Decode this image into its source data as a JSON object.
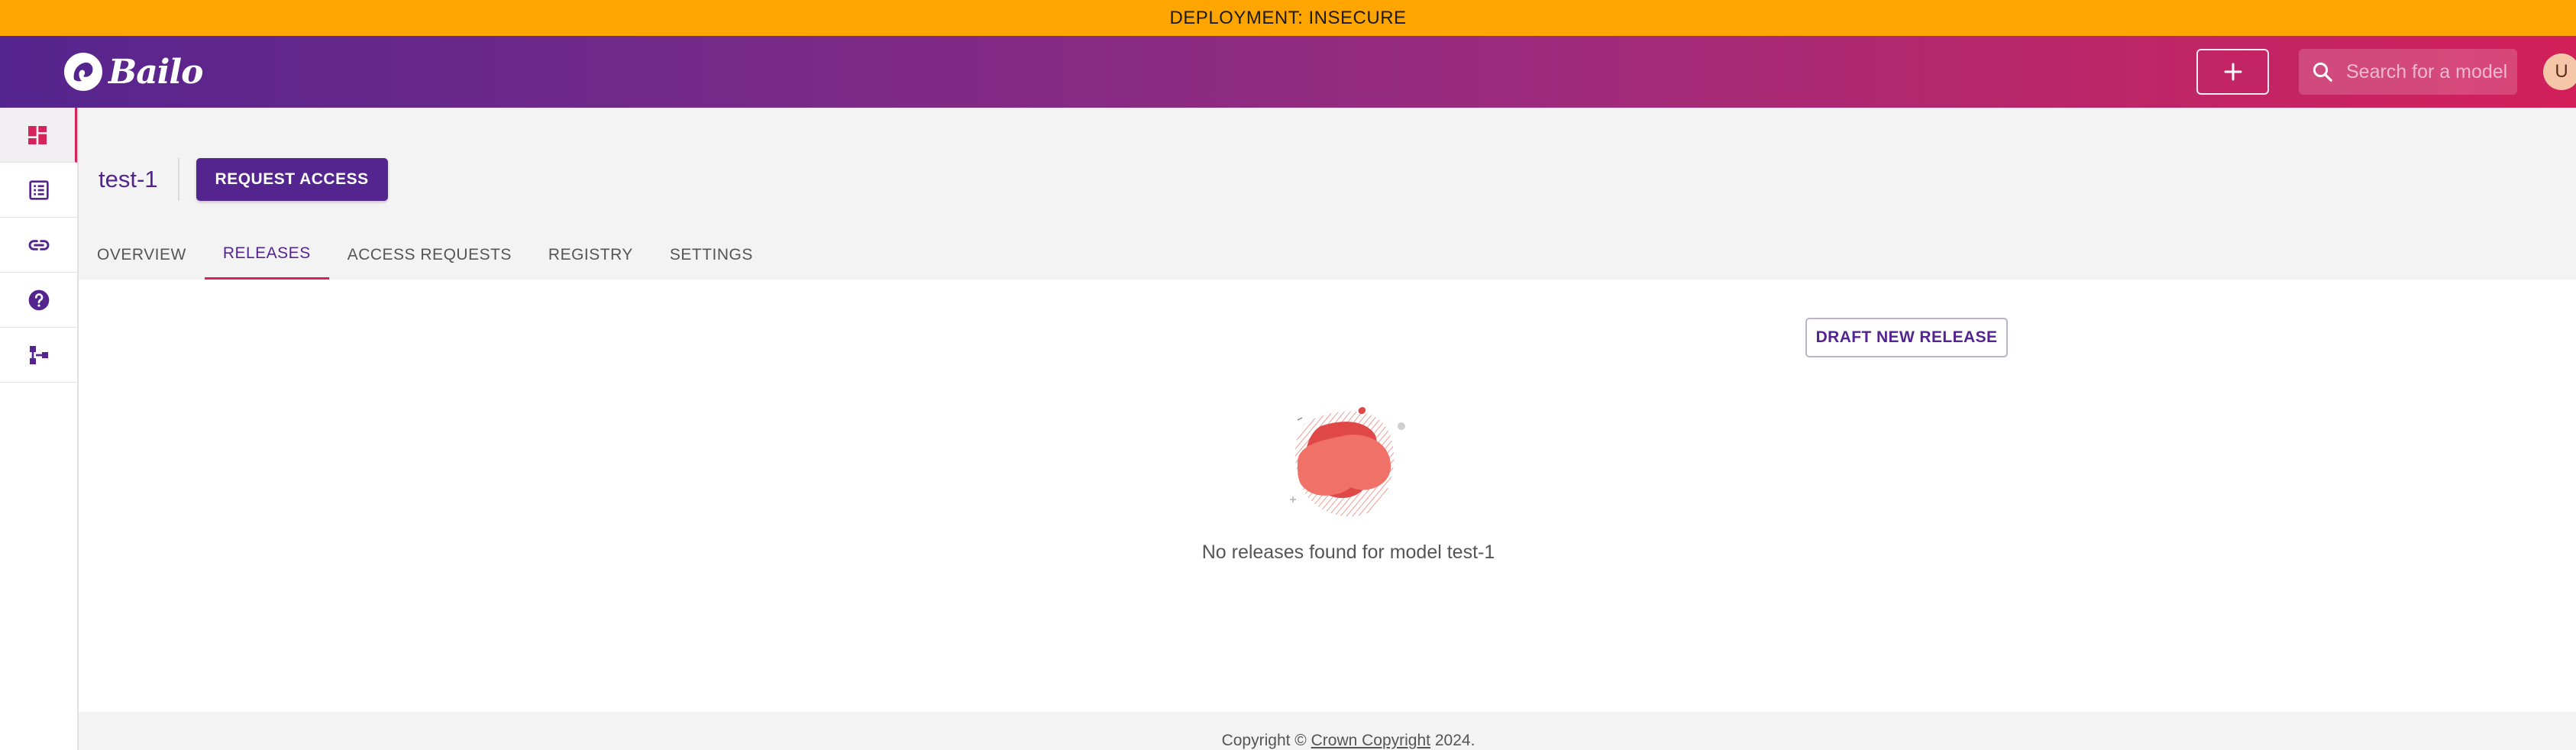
{
  "banner": {
    "text": "DEPLOYMENT: INSECURE"
  },
  "header": {
    "logo_text": "Bailo",
    "add_icon": "plus-icon",
    "search": {
      "placeholder": "Search for a model",
      "value": "",
      "icon": "search-icon"
    },
    "avatar_initial": "U"
  },
  "sidebar": {
    "items": [
      {
        "name": "dashboard",
        "icon": "dashboard-icon",
        "active": true
      },
      {
        "name": "reviews",
        "icon": "list-icon",
        "active": false
      },
      {
        "name": "links",
        "icon": "link-icon",
        "active": false
      },
      {
        "name": "help",
        "icon": "help-icon",
        "active": false
      },
      {
        "name": "schemas",
        "icon": "schema-icon",
        "active": false
      }
    ]
  },
  "model": {
    "title": "test-1",
    "request_access_label": "REQUEST ACCESS"
  },
  "tabs": [
    {
      "label": "OVERVIEW",
      "active": false
    },
    {
      "label": "RELEASES",
      "active": true
    },
    {
      "label": "ACCESS REQUESTS",
      "active": false
    },
    {
      "label": "REGISTRY",
      "active": false
    },
    {
      "label": "SETTINGS",
      "active": false
    }
  ],
  "releases": {
    "draft_label": "DRAFT NEW RELEASE",
    "empty_message": "No releases found for model test-1"
  },
  "footer": {
    "prefix": "Copyright ©",
    "link": "Crown Copyright",
    "suffix": "2024."
  },
  "colors": {
    "banner": "#ffa500",
    "primary": "#55258f",
    "accent": "#d4245b",
    "blob": "#f07168"
  }
}
